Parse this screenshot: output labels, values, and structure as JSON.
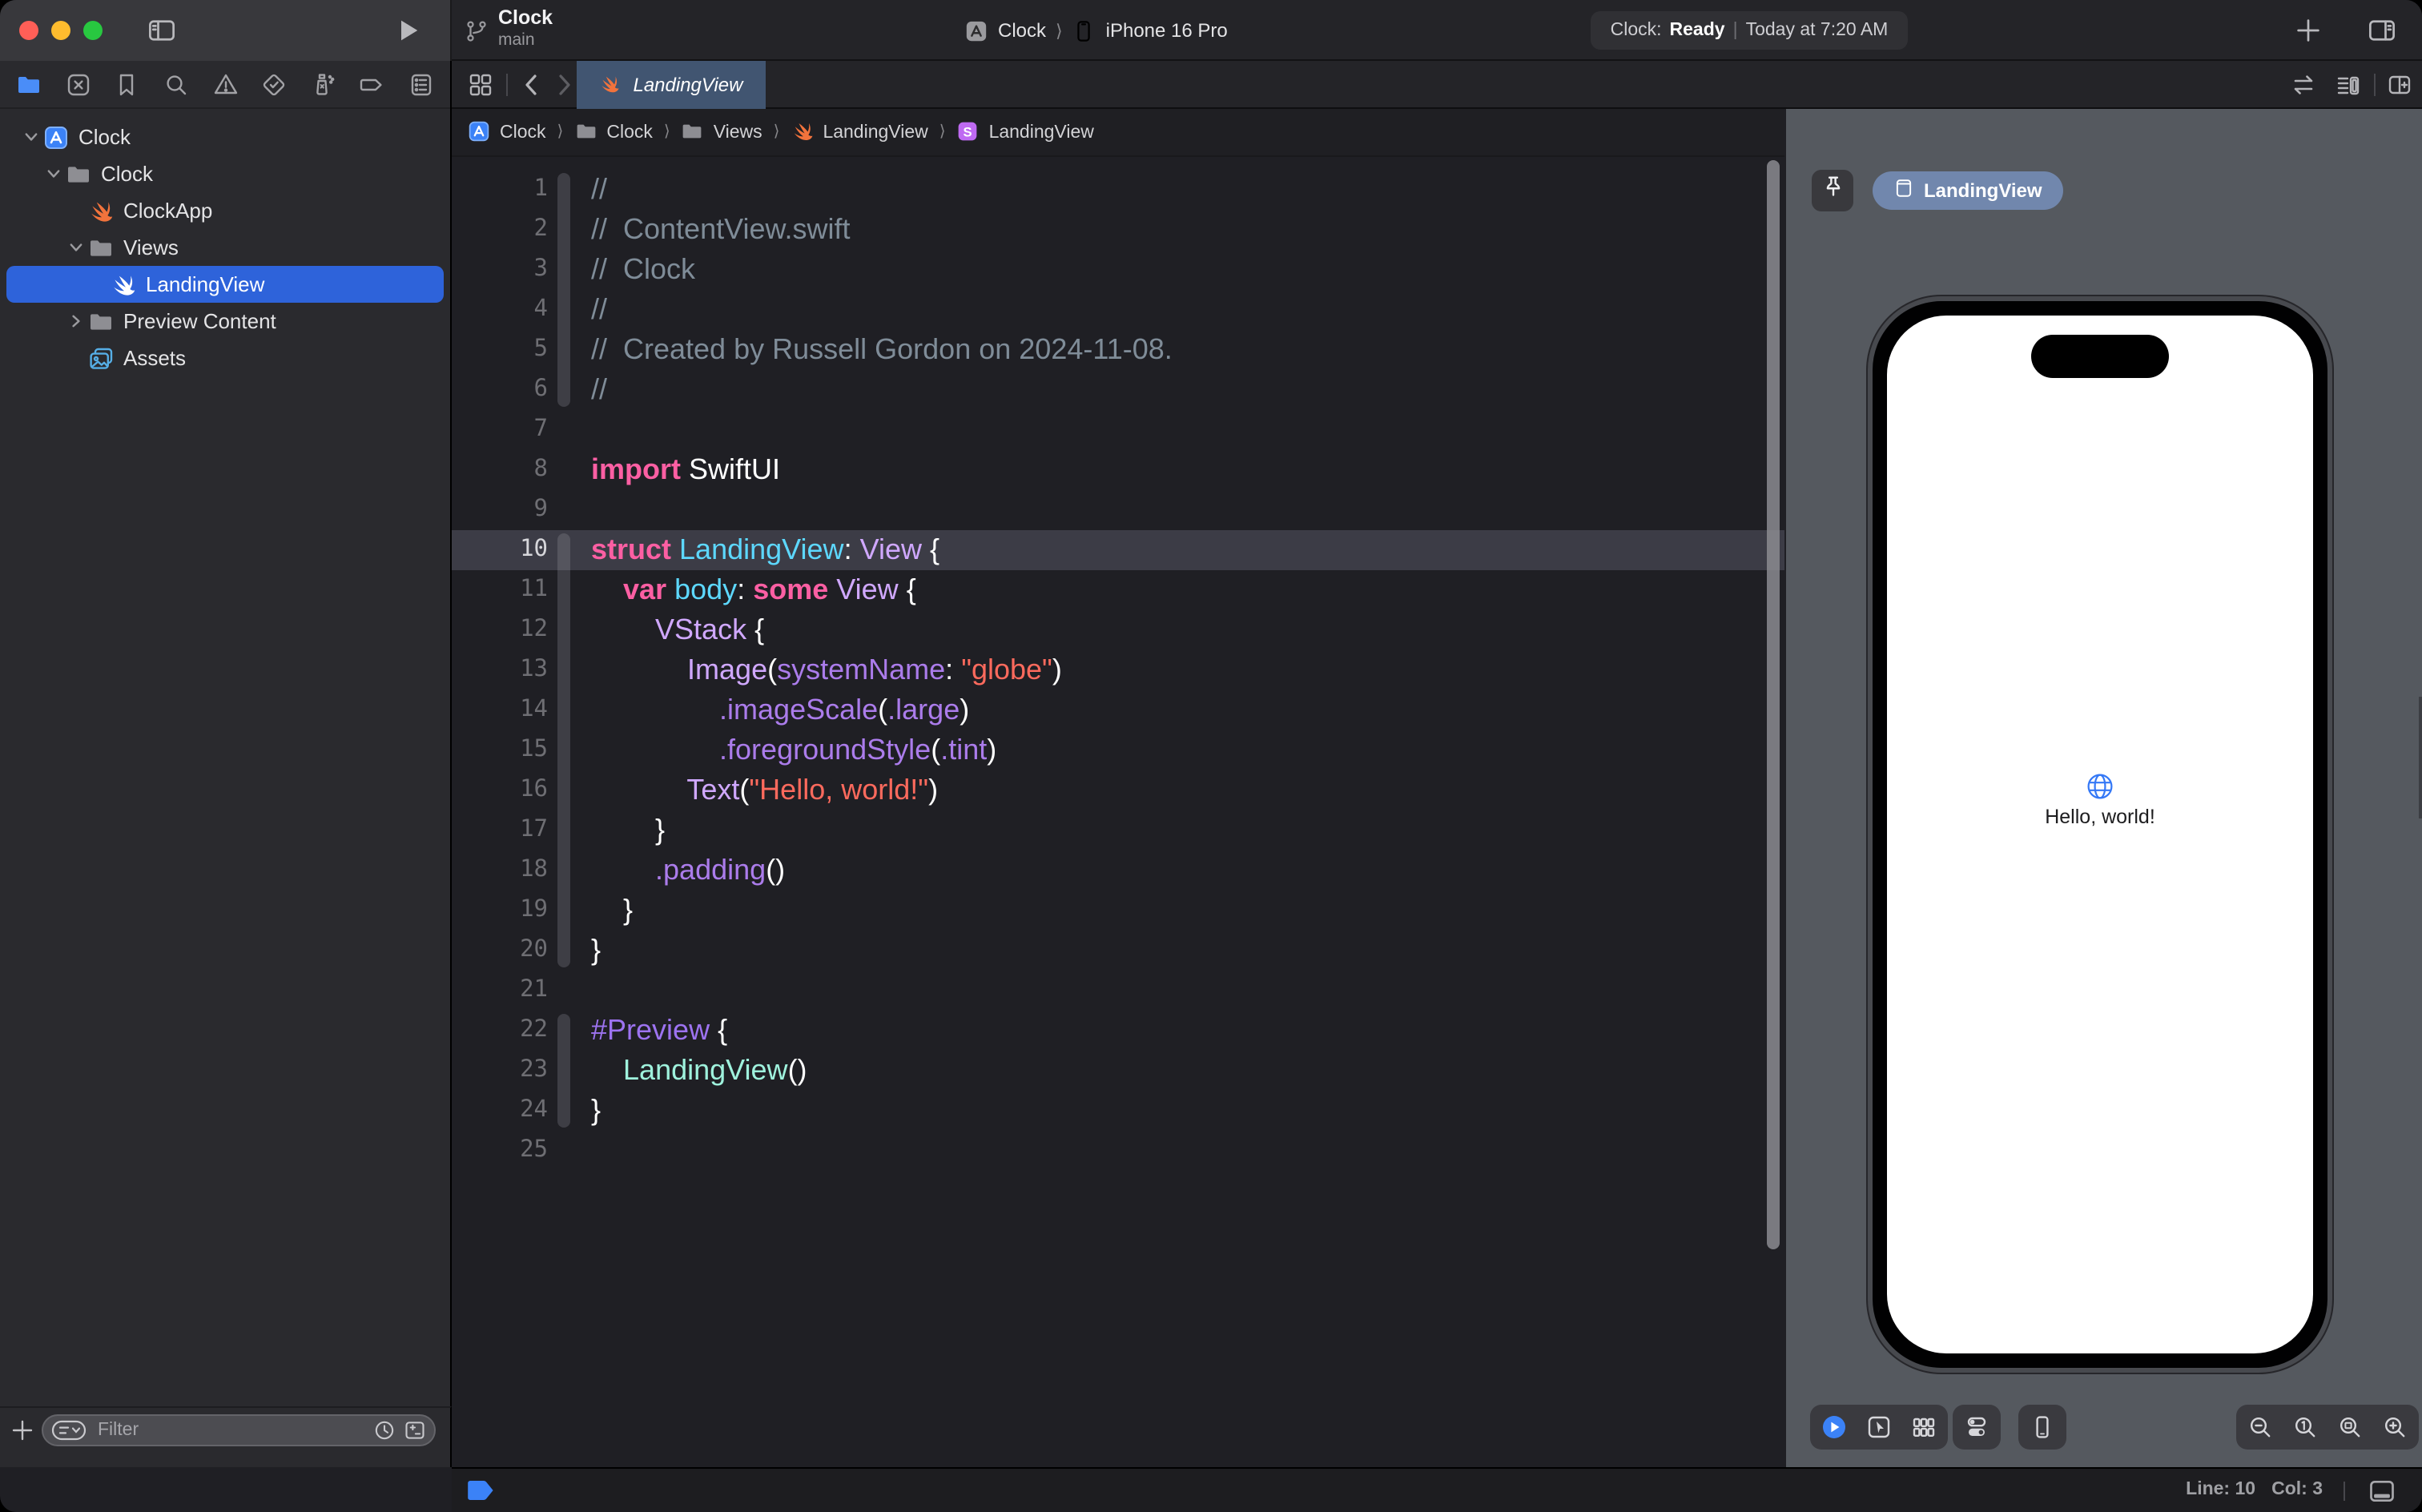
{
  "titlebar": {
    "project_name": "Clock",
    "branch_name": "main",
    "run_destination": {
      "project": "Clock",
      "separator": "⟩",
      "device": "iPhone 16 Pro"
    },
    "activity": {
      "app": "Clock:",
      "state": "Ready",
      "divider": "|",
      "detail": "Today at 7:20 AM"
    }
  },
  "navigator": {
    "tabs": [
      {
        "icon": "nav-project",
        "name": "project-navigator",
        "active": true
      },
      {
        "icon": "nav-changes",
        "name": "source-control-navigator",
        "active": false
      },
      {
        "icon": "nav-bookmarks",
        "name": "bookmarks-navigator",
        "active": false
      },
      {
        "icon": "nav-find",
        "name": "find-navigator",
        "active": false
      },
      {
        "icon": "nav-issues",
        "name": "issues-navigator",
        "active": false
      },
      {
        "icon": "nav-tests",
        "name": "tests-navigator",
        "active": false
      },
      {
        "icon": "nav-debug",
        "name": "debug-navigator",
        "active": false
      },
      {
        "icon": "nav-breakpoints",
        "name": "breakpoints-navigator",
        "active": false
      },
      {
        "icon": "nav-reports",
        "name": "reports-navigator",
        "active": false
      }
    ],
    "tree": [
      {
        "label": "Clock",
        "icon": "appstore",
        "chevron": "down",
        "indent": 0,
        "selected": false
      },
      {
        "label": "Clock",
        "icon": "folder",
        "chevron": "down",
        "indent": 1,
        "selected": false
      },
      {
        "label": "ClockApp",
        "icon": "swift-orange",
        "chevron": "",
        "indent": 2,
        "selected": false
      },
      {
        "label": "Views",
        "icon": "folder",
        "chevron": "down",
        "indent": 2,
        "selected": false
      },
      {
        "label": "LandingView",
        "icon": "swift-white",
        "chevron": "",
        "indent": 3,
        "selected": true
      },
      {
        "label": "Preview Content",
        "icon": "folder",
        "chevron": "right",
        "indent": 2,
        "selected": false
      },
      {
        "label": "Assets",
        "icon": "assets",
        "chevron": "",
        "indent": 2,
        "selected": false
      }
    ],
    "filter_placeholder": "Filter"
  },
  "editor": {
    "tab_label": "LandingView",
    "breadcrumb_separator": "⟩",
    "breadcrumbs": [
      {
        "label": "Clock",
        "icon": "appstore"
      },
      {
        "label": "Clock",
        "icon": "folder"
      },
      {
        "label": "Views",
        "icon": "folder"
      },
      {
        "label": "LandingView",
        "icon": "swift-orange"
      },
      {
        "label": "LandingView",
        "icon": "symbol-s"
      }
    ],
    "current_line": 10,
    "status": {
      "line_text": "Line: 10",
      "col_text": "Col: 3"
    },
    "code_lines": [
      {
        "n": 1,
        "fold": "top",
        "tokens": [
          {
            "t": "//",
            "c": "com"
          }
        ]
      },
      {
        "n": 2,
        "fold": "mid",
        "tokens": [
          {
            "t": "//  ContentView.swift",
            "c": "com"
          }
        ]
      },
      {
        "n": 3,
        "fold": "mid",
        "tokens": [
          {
            "t": "//  Clock",
            "c": "com"
          }
        ]
      },
      {
        "n": 4,
        "fold": "mid",
        "tokens": [
          {
            "t": "//",
            "c": "com"
          }
        ]
      },
      {
        "n": 5,
        "fold": "mid",
        "tokens": [
          {
            "t": "//  Created by Russell Gordon on 2024-11-08.",
            "c": "com"
          }
        ]
      },
      {
        "n": 6,
        "fold": "bot",
        "tokens": [
          {
            "t": "//",
            "c": "com"
          }
        ]
      },
      {
        "n": 7,
        "fold": "",
        "tokens": []
      },
      {
        "n": 8,
        "fold": "",
        "tokens": [
          {
            "t": "import",
            "c": "kw"
          },
          {
            "t": " SwiftUI",
            "c": "pln"
          }
        ]
      },
      {
        "n": 9,
        "fold": "",
        "tokens": []
      },
      {
        "n": 10,
        "hl": true,
        "fold": "top",
        "tokens": [
          {
            "t": "struct ",
            "c": "kw"
          },
          {
            "t": "LandingView",
            "c": "decl"
          },
          {
            "t": ": ",
            "c": "pln"
          },
          {
            "t": "View",
            "c": "type"
          },
          {
            "t": " {",
            "c": "pln"
          }
        ]
      },
      {
        "n": 11,
        "fold": "mid",
        "tokens": [
          {
            "t": "    ",
            "c": "pln"
          },
          {
            "t": "var ",
            "c": "kw"
          },
          {
            "t": "body",
            "c": "decl"
          },
          {
            "t": ": ",
            "c": "pln"
          },
          {
            "t": "some ",
            "c": "kw"
          },
          {
            "t": "View",
            "c": "type"
          },
          {
            "t": " {",
            "c": "pln"
          }
        ]
      },
      {
        "n": 12,
        "fold": "mid",
        "tokens": [
          {
            "t": "        ",
            "c": "pln"
          },
          {
            "t": "VStack",
            "c": "type"
          },
          {
            "t": " {",
            "c": "pln"
          }
        ]
      },
      {
        "n": 13,
        "fold": "mid",
        "tokens": [
          {
            "t": "            ",
            "c": "pln"
          },
          {
            "t": "Image",
            "c": "type"
          },
          {
            "t": "(",
            "c": "pln"
          },
          {
            "t": "systemName",
            "c": "mem"
          },
          {
            "t": ": ",
            "c": "pln"
          },
          {
            "t": "\"globe\"",
            "c": "str"
          },
          {
            "t": ")",
            "c": "pln"
          }
        ]
      },
      {
        "n": 14,
        "fold": "mid",
        "tokens": [
          {
            "t": "                ",
            "c": "pln"
          },
          {
            "t": ".imageScale",
            "c": "mem"
          },
          {
            "t": "(",
            "c": "pln"
          },
          {
            "t": ".large",
            "c": "mem"
          },
          {
            "t": ")",
            "c": "pln"
          }
        ]
      },
      {
        "n": 15,
        "fold": "mid",
        "tokens": [
          {
            "t": "                ",
            "c": "pln"
          },
          {
            "t": ".foregroundStyle",
            "c": "mem"
          },
          {
            "t": "(",
            "c": "pln"
          },
          {
            "t": ".tint",
            "c": "mem"
          },
          {
            "t": ")",
            "c": "pln"
          }
        ]
      },
      {
        "n": 16,
        "fold": "mid",
        "tokens": [
          {
            "t": "            ",
            "c": "pln"
          },
          {
            "t": "Text",
            "c": "type"
          },
          {
            "t": "(",
            "c": "pln"
          },
          {
            "t": "\"Hello, world!\"",
            "c": "str"
          },
          {
            "t": ")",
            "c": "pln"
          }
        ]
      },
      {
        "n": 17,
        "fold": "mid",
        "tokens": [
          {
            "t": "        }",
            "c": "pln"
          }
        ]
      },
      {
        "n": 18,
        "fold": "mid",
        "tokens": [
          {
            "t": "        ",
            "c": "pln"
          },
          {
            "t": ".padding",
            "c": "mem"
          },
          {
            "t": "()",
            "c": "pln"
          }
        ]
      },
      {
        "n": 19,
        "fold": "mid",
        "tokens": [
          {
            "t": "    }",
            "c": "pln"
          }
        ]
      },
      {
        "n": 20,
        "fold": "bot",
        "tokens": [
          {
            "t": "}",
            "c": "pln"
          }
        ]
      },
      {
        "n": 21,
        "fold": "",
        "tokens": []
      },
      {
        "n": 22,
        "fold": "top",
        "tokens": [
          {
            "t": "#Preview",
            "c": "mac"
          },
          {
            "t": " {",
            "c": "pln"
          }
        ]
      },
      {
        "n": 23,
        "fold": "mid",
        "tokens": [
          {
            "t": "    ",
            "c": "pln"
          },
          {
            "t": "LandingView",
            "c": "mint"
          },
          {
            "t": "()",
            "c": "pln"
          }
        ]
      },
      {
        "n": 24,
        "fold": "bot",
        "tokens": [
          {
            "t": "}",
            "c": "pln"
          }
        ]
      },
      {
        "n": 25,
        "fold": "",
        "tokens": []
      }
    ]
  },
  "preview": {
    "device_tab_label": "LandingView",
    "screen_text": "Hello, world!",
    "controls_left": [
      {
        "icon": "live-preview",
        "name": "live-preview-button",
        "active": true
      },
      {
        "icon": "selectable",
        "name": "selectable-mode-button",
        "active": false
      },
      {
        "icon": "variants",
        "name": "variants-button",
        "active": false
      }
    ],
    "controls_settings": [
      {
        "icon": "device-settings",
        "name": "device-settings-button",
        "active": false
      }
    ],
    "controls_device": [
      {
        "icon": "device",
        "name": "device-button",
        "active": false
      }
    ],
    "controls_zoom": [
      {
        "icon": "zoom-out",
        "name": "zoom-out-button",
        "active": false
      },
      {
        "icon": "zoom-100",
        "name": "zoom-actual-size-button",
        "active": false
      },
      {
        "icon": "zoom-fit",
        "name": "zoom-to-fit-button",
        "active": false
      },
      {
        "icon": "zoom-in",
        "name": "zoom-in-button",
        "active": false
      }
    ]
  },
  "colors": {
    "accent_blue": "#3478f6",
    "selection_blue": "#2e63da",
    "active_tab": "#415571",
    "preview_background": "#55595f",
    "editor_background": "#1f1f24",
    "keyword": "#fc5fa3",
    "declaration": "#5dd8ff",
    "type": "#d0a8ff",
    "member": "#ab7ceb",
    "string": "#fc6a5d",
    "comment": "#7f8c98",
    "macro": "#9d73f1",
    "project_reference": "#9ff2dd"
  }
}
